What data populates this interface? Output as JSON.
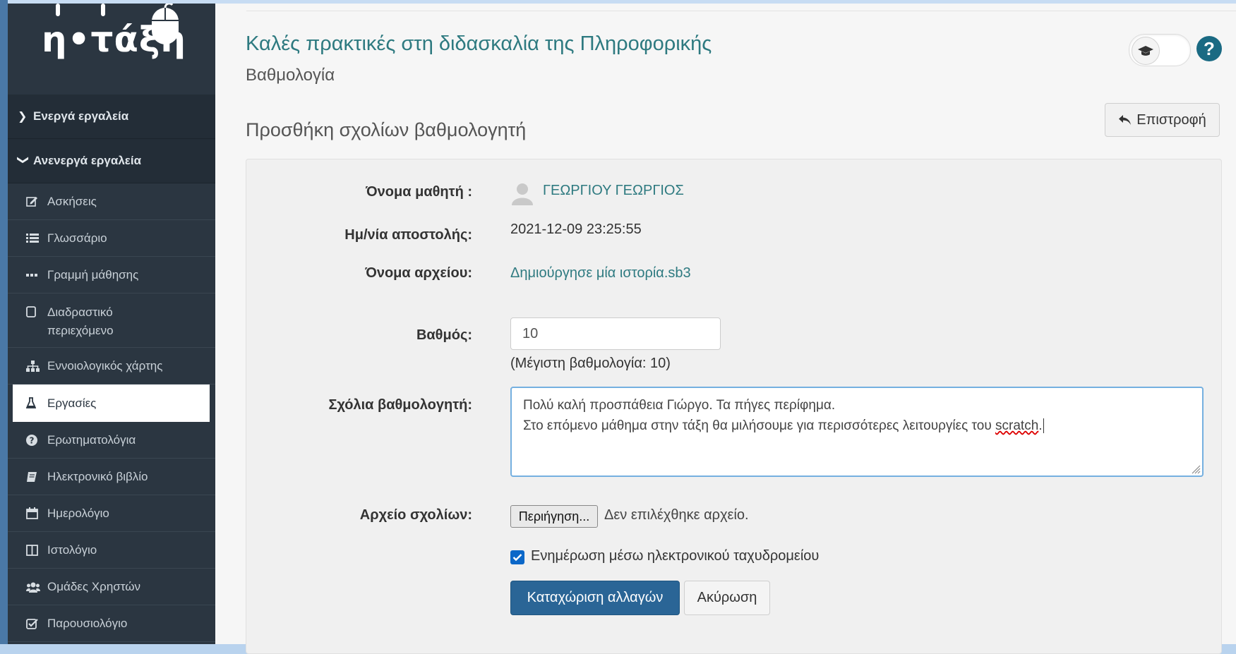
{
  "logo": {
    "text": "η•τάξη"
  },
  "sidebar": {
    "sections": [
      {
        "label": "Ενεργά εργαλεία",
        "expanded": false
      },
      {
        "label": "Ανενεργά εργαλεία",
        "expanded": true
      }
    ],
    "items": [
      {
        "label": "Ασκήσεις",
        "icon": "edit-icon"
      },
      {
        "label": "Γλωσσάριο",
        "icon": "list-icon"
      },
      {
        "label": "Γραμμή μάθησης",
        "icon": "ellipsis-icon"
      },
      {
        "label": "Διαδραστικό",
        "label2": "περιεχόμενο",
        "icon": "square-icon"
      },
      {
        "label": "Εννοιολογικός χάρτης",
        "icon": "sitemap-icon"
      },
      {
        "label": "Εργασίες",
        "icon": "flask-icon",
        "active": true
      },
      {
        "label": "Ερωτηματολόγια",
        "icon": "question-circle-icon"
      },
      {
        "label": "Ηλεκτρονικό βιβλίο",
        "icon": "book-icon"
      },
      {
        "label": "Ημερολόγιο",
        "icon": "calendar-icon"
      },
      {
        "label": "Ιστολόγιο",
        "icon": "columns-icon"
      },
      {
        "label": "Ομάδες Χρηστών",
        "icon": "users-icon"
      },
      {
        "label": "Παρουσιολόγιο",
        "icon": "check-square-icon"
      }
    ]
  },
  "header": {
    "course_title": "Καλές πρακτικές στη διδασκαλία της Πληροφορικής",
    "subtitle": "Βαθμολογία",
    "help_glyph": "?"
  },
  "page": {
    "section_title": "Προσθήκη σχολίων βαθμολογητή",
    "back_button": "Επιστροφή"
  },
  "form": {
    "student_label": "Όνομα μαθητή :",
    "student_name": "ΓΕΩΡΓΙΟΥ ΓΕΩΡΓΙΟΣ",
    "date_label": "Ημ/νία αποστολής:",
    "date_value": "2021-12-09 23:25:55",
    "file_label": "Όνομα αρχείου:",
    "file_name": "Δημιούργησε μία ιστορία.sb3",
    "grade_label": "Βαθμός:",
    "grade_value": "10",
    "grade_max": "(Μέγιστη βαθμολογία: 10)",
    "comments_label": "Σχόλια βαθμολογητή:",
    "comments_line1": "Πολύ καλή προσπάθεια Γιώργο. Τα πήγες περίφημα.",
    "comments_line2": "Στο επόμενο μάθημα στην τάξη θα μιλήσουμε για περισσότερες λειτουργίες του ",
    "comments_spell": "scratch",
    "comments_end": ".",
    "comment_file_label": "Αρχείο σχολίων:",
    "browse_button": "Περιήγηση...",
    "no_file_text": "Δεν επιλέχθηκε αρχείο.",
    "email_notify_label": "Ενημέρωση μέσω ηλεκτρονικού ταχυδρομείου",
    "email_notify_checked": true,
    "save_button": "Καταχώριση αλλαγών",
    "cancel_button": "Ακύρωση"
  },
  "colors": {
    "sidebar_bg": "#2b3641",
    "accent_link": "#2e7a80",
    "primary_button": "#2a6596"
  }
}
